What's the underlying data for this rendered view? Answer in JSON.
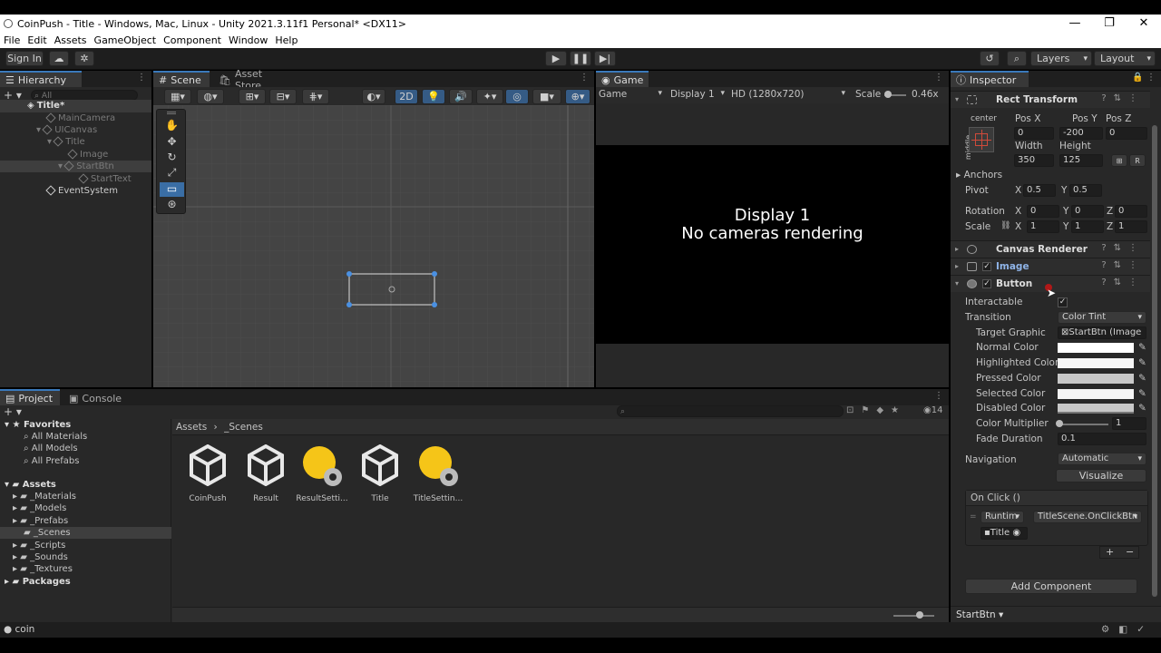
{
  "window": {
    "title": "CoinPush - Title - Windows, Mac, Linux - Unity 2021.3.11f1 Personal* <DX11>",
    "controls": [
      "—",
      "❐",
      "✕"
    ]
  },
  "menu": [
    "File",
    "Edit",
    "Assets",
    "GameObject",
    "Component",
    "Window",
    "Help"
  ],
  "toolbar": {
    "sign_in": "Sign In",
    "layers": "Layers",
    "layout": "Layout"
  },
  "hierarchy": {
    "tab": "Hierarchy",
    "search_placeholder": "All",
    "items": [
      {
        "label": "Title*",
        "depth": 0
      },
      {
        "label": "MainCamera",
        "depth": 1
      },
      {
        "label": "UICanvas",
        "depth": 1
      },
      {
        "label": "Title",
        "depth": 2
      },
      {
        "label": "Image",
        "depth": 3
      },
      {
        "label": "StartBtn",
        "depth": 3
      },
      {
        "label": "StartText",
        "depth": 4
      },
      {
        "label": "EventSystem",
        "depth": 1
      }
    ]
  },
  "scene": {
    "tabs": [
      "Scene",
      "Asset Store"
    ],
    "mode_2d": "2D"
  },
  "game": {
    "tab": "Game",
    "mode": "Game",
    "display": "Display 1",
    "resolution": "HD (1280x720)",
    "scale_label": "Scale",
    "scale_value": "0.46x",
    "message_line1": "Display 1",
    "message_line2": "No cameras rendering"
  },
  "project": {
    "tabs": [
      "Project",
      "Console"
    ],
    "badge": "14",
    "favorites": {
      "label": "Favorites",
      "items": [
        "All Materials",
        "All Models",
        "All Prefabs"
      ]
    },
    "assets": {
      "label": "Assets",
      "items": [
        "_Materials",
        "_Models",
        "_Prefabs",
        "_Scenes",
        "_Scripts",
        "_Sounds",
        "_Textures"
      ]
    },
    "packages": "Packages",
    "breadcrumb": [
      "Assets",
      "_Scenes"
    ],
    "files": [
      {
        "name": "CoinPush",
        "kind": "unity"
      },
      {
        "name": "Result",
        "kind": "unity"
      },
      {
        "name": "ResultSetti...",
        "kind": "settings"
      },
      {
        "name": "Title",
        "kind": "unity"
      },
      {
        "name": "TitleSettin...",
        "kind": "settings"
      }
    ]
  },
  "status": {
    "message": "coin"
  },
  "inspector": {
    "tab": "Inspector",
    "rect_transform": {
      "title": "Rect Transform",
      "anchor_h": "center",
      "anchor_v": "middle",
      "pos_x_label": "Pos X",
      "pos_x": "0",
      "pos_y_label": "Pos Y",
      "pos_y": "-200",
      "pos_z_label": "Pos Z",
      "pos_z": "0",
      "width_label": "Width",
      "width": "350",
      "height_label": "Height",
      "height": "125",
      "r_label": "R",
      "anchors": "Anchors",
      "pivot": "Pivot",
      "pivot_x": "0.5",
      "pivot_y": "0.5",
      "rotation": "Rotation",
      "rot_x": "0",
      "rot_y": "0",
      "rot_z": "0",
      "scale": "Scale",
      "scale_x": "1",
      "scale_y": "1",
      "scale_z": "1"
    },
    "canvas_renderer": "Canvas Renderer",
    "image": "Image",
    "button": {
      "title": "Button",
      "interactable": "Interactable",
      "transition": "Transition",
      "transition_value": "Color Tint",
      "target_graphic": "Target Graphic",
      "target_graphic_value": "StartBtn (Image",
      "normal_color": "Normal Color",
      "highlighted_color": "Highlighted Color",
      "pressed_color": "Pressed Color",
      "selected_color": "Selected Color",
      "disabled_color": "Disabled Color",
      "color_multiplier": "Color Multiplier",
      "color_multiplier_value": "1",
      "fade_duration": "Fade Duration",
      "fade_duration_value": "0.1",
      "navigation": "Navigation",
      "navigation_value": "Automatic",
      "visualize": "Visualize",
      "on_click": "On Click ()",
      "runtime": "Runtim",
      "function": "TitleScene.OnClickBtn",
      "object": "Title",
      "plus": "+",
      "minus": "−"
    },
    "add_component": "Add Component",
    "footer": "StartBtn"
  },
  "colors": {
    "panel": "#282828",
    "accent": "#3a79bb",
    "handle": "#4a90e2",
    "folder_yellow": "#f5c518"
  }
}
